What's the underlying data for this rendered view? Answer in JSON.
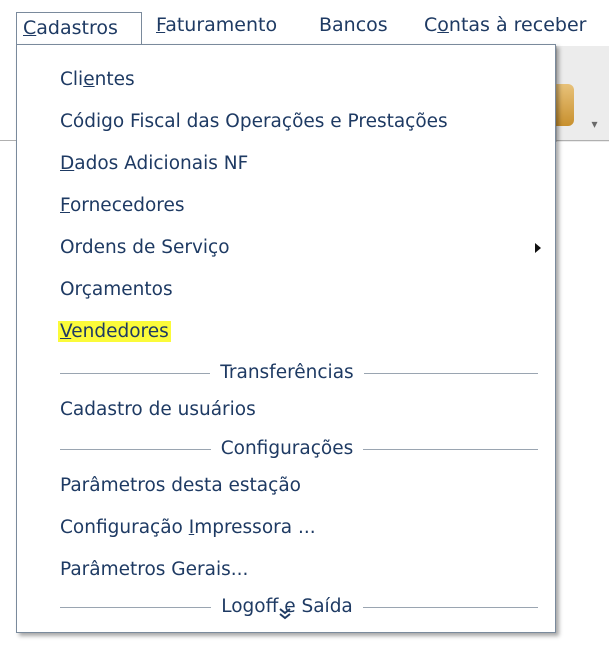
{
  "menubar": {
    "items": [
      {
        "label_u": "C",
        "label_rest": "adastros"
      },
      {
        "label_u": "F",
        "label_rest": "aturamento"
      },
      {
        "label": "Bancos"
      },
      {
        "label_pre": "C",
        "label_u": "o",
        "label_rest": "ntas à receber"
      }
    ]
  },
  "menu": {
    "items": [
      {
        "pre": "Cli",
        "u": "e",
        "post": "ntes"
      },
      {
        "label": "Código Fiscal das Operações e Prestações"
      },
      {
        "u": "D",
        "post": "ados Adicionais NF"
      },
      {
        "u": "F",
        "post": "ornecedores"
      },
      {
        "label": "Ordens de Serviço"
      },
      {
        "label": "Orçamentos"
      },
      {
        "u": "V",
        "post": "endedores"
      },
      {
        "label": "Cadastro de usuários"
      },
      {
        "label": "Parâmetros desta estação"
      },
      {
        "pre": "Configuração ",
        "u": "I",
        "post": "mpressora ..."
      },
      {
        "label": "Parâmetros Gerais..."
      }
    ],
    "separators": {
      "transfer": "Transferências",
      "config": "Configurações",
      "logoff": "Logoff e Saída"
    },
    "expand_icon": "double-chevron-down-icon"
  },
  "colors": {
    "menu_text": "#1e3a63",
    "highlight": "#fbfb3a",
    "border": "#7a8a9c"
  }
}
